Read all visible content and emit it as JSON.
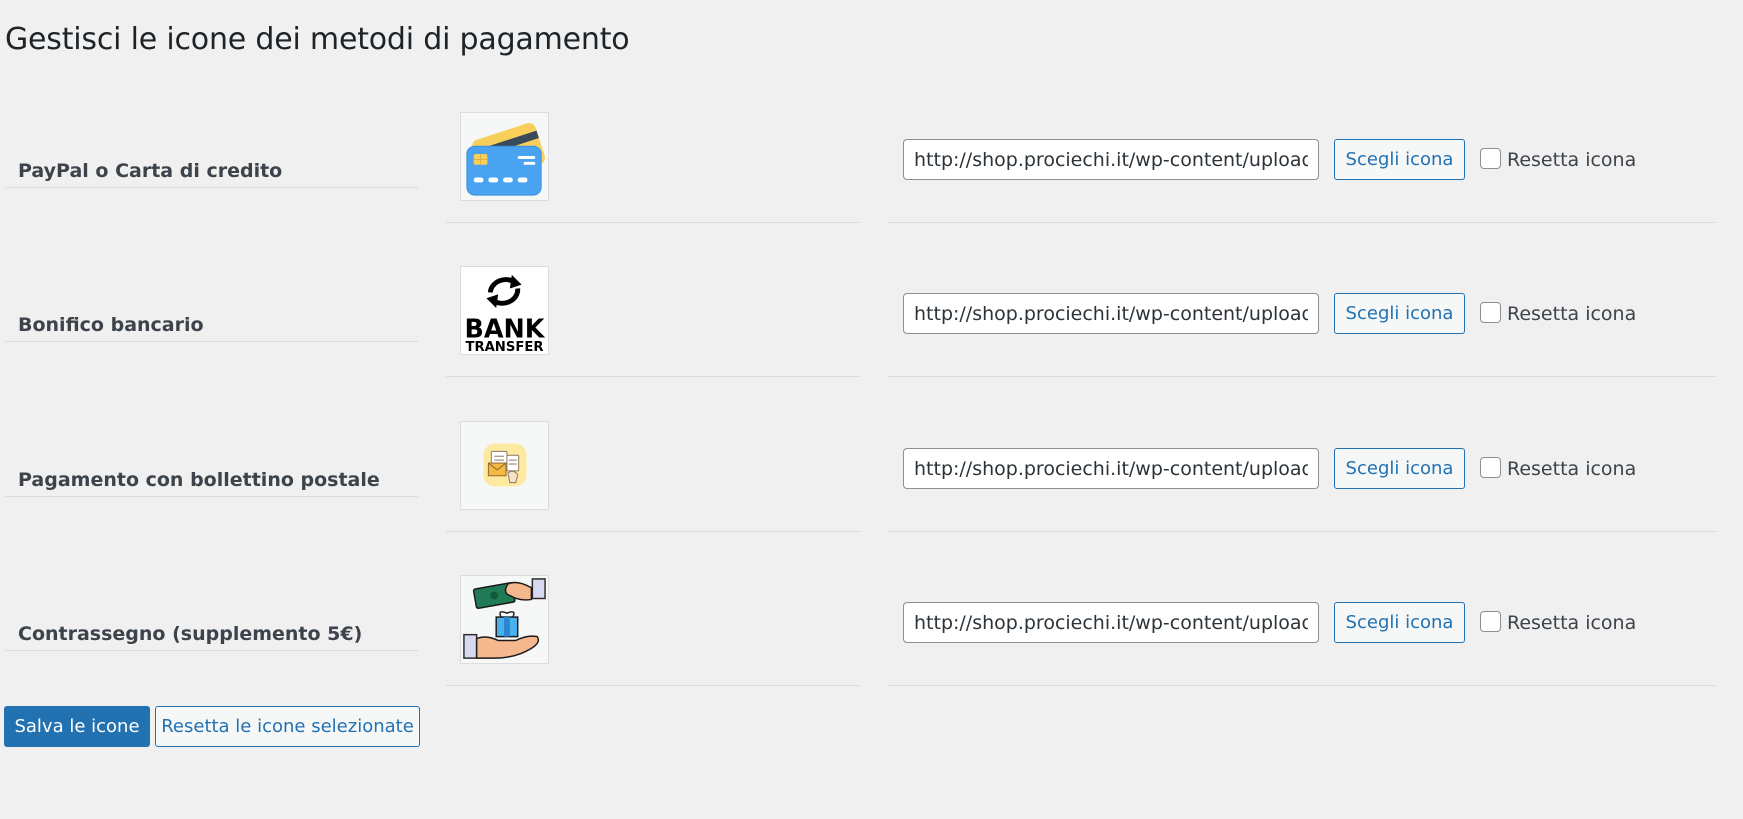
{
  "page": {
    "title": "Gestisci le icone dei metodi di pagamento"
  },
  "methods": [
    {
      "label": "PayPal o Carta di credito",
      "icon": "credit-card-icon",
      "url": "http://shop.prociechi.it/wp-content/uploads/",
      "choose_label": "Scegli icona",
      "reset_label": "Resetta icona"
    },
    {
      "label": "Bonifico bancario",
      "icon": "bank-transfer-icon",
      "icon_text_top": "BANK",
      "icon_text_bottom": "TRANSFER",
      "url": "http://shop.prociechi.it/wp-content/uploads/",
      "choose_label": "Scegli icona",
      "reset_label": "Resetta icona"
    },
    {
      "label": "Pagamento con bollettino postale",
      "icon": "postal-slip-icon",
      "url": "http://shop.prociechi.it/wp-content/uploads/",
      "choose_label": "Scegli icona",
      "reset_label": "Resetta icona"
    },
    {
      "label": "Contrassegno (supplemento 5€)",
      "icon": "cash-on-delivery-icon",
      "url": "http://shop.prociechi.it/wp-content/uploads/",
      "choose_label": "Scegli icona",
      "reset_label": "Resetta icona"
    }
  ],
  "actions": {
    "save_label": "Salva le icone",
    "reset_selected_label": "Resetta le icone selezionate"
  },
  "colors": {
    "background": "#f0f0f1",
    "accent": "#2271b1",
    "text": "#1d2327",
    "divider": "#dcdcde"
  }
}
